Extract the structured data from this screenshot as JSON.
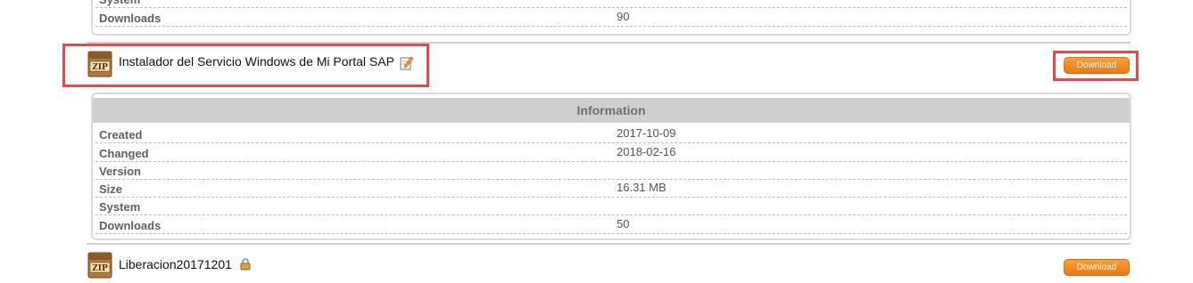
{
  "top_panel": {
    "rows": [
      {
        "label": "System",
        "value": ""
      },
      {
        "label": "Downloads",
        "value": "90"
      }
    ]
  },
  "files": [
    {
      "title": "Instalador del Servicio Windows de Mi Portal SAP",
      "icon": "zip-archive-icon",
      "badge_icon": "edit-icon",
      "download_label": "Download"
    },
    {
      "title": "Liberacion20171201",
      "icon": "zip-archive-icon",
      "badge_icon": "lock-icon",
      "download_label": "Download"
    }
  ],
  "info": {
    "header": "Information",
    "rows": [
      {
        "label": "Created",
        "value": "2017-10-09"
      },
      {
        "label": "Changed",
        "value": "2018-02-16"
      },
      {
        "label": "Version",
        "value": ""
      },
      {
        "label": "Size",
        "value": "16.31 MB"
      },
      {
        "label": "System",
        "value": ""
      },
      {
        "label": "Downloads",
        "value": "50"
      }
    ]
  },
  "icon_labels": {
    "zip": "ZIP"
  },
  "colors": {
    "accent": "#f08c22",
    "highlight": "#e8474f"
  }
}
